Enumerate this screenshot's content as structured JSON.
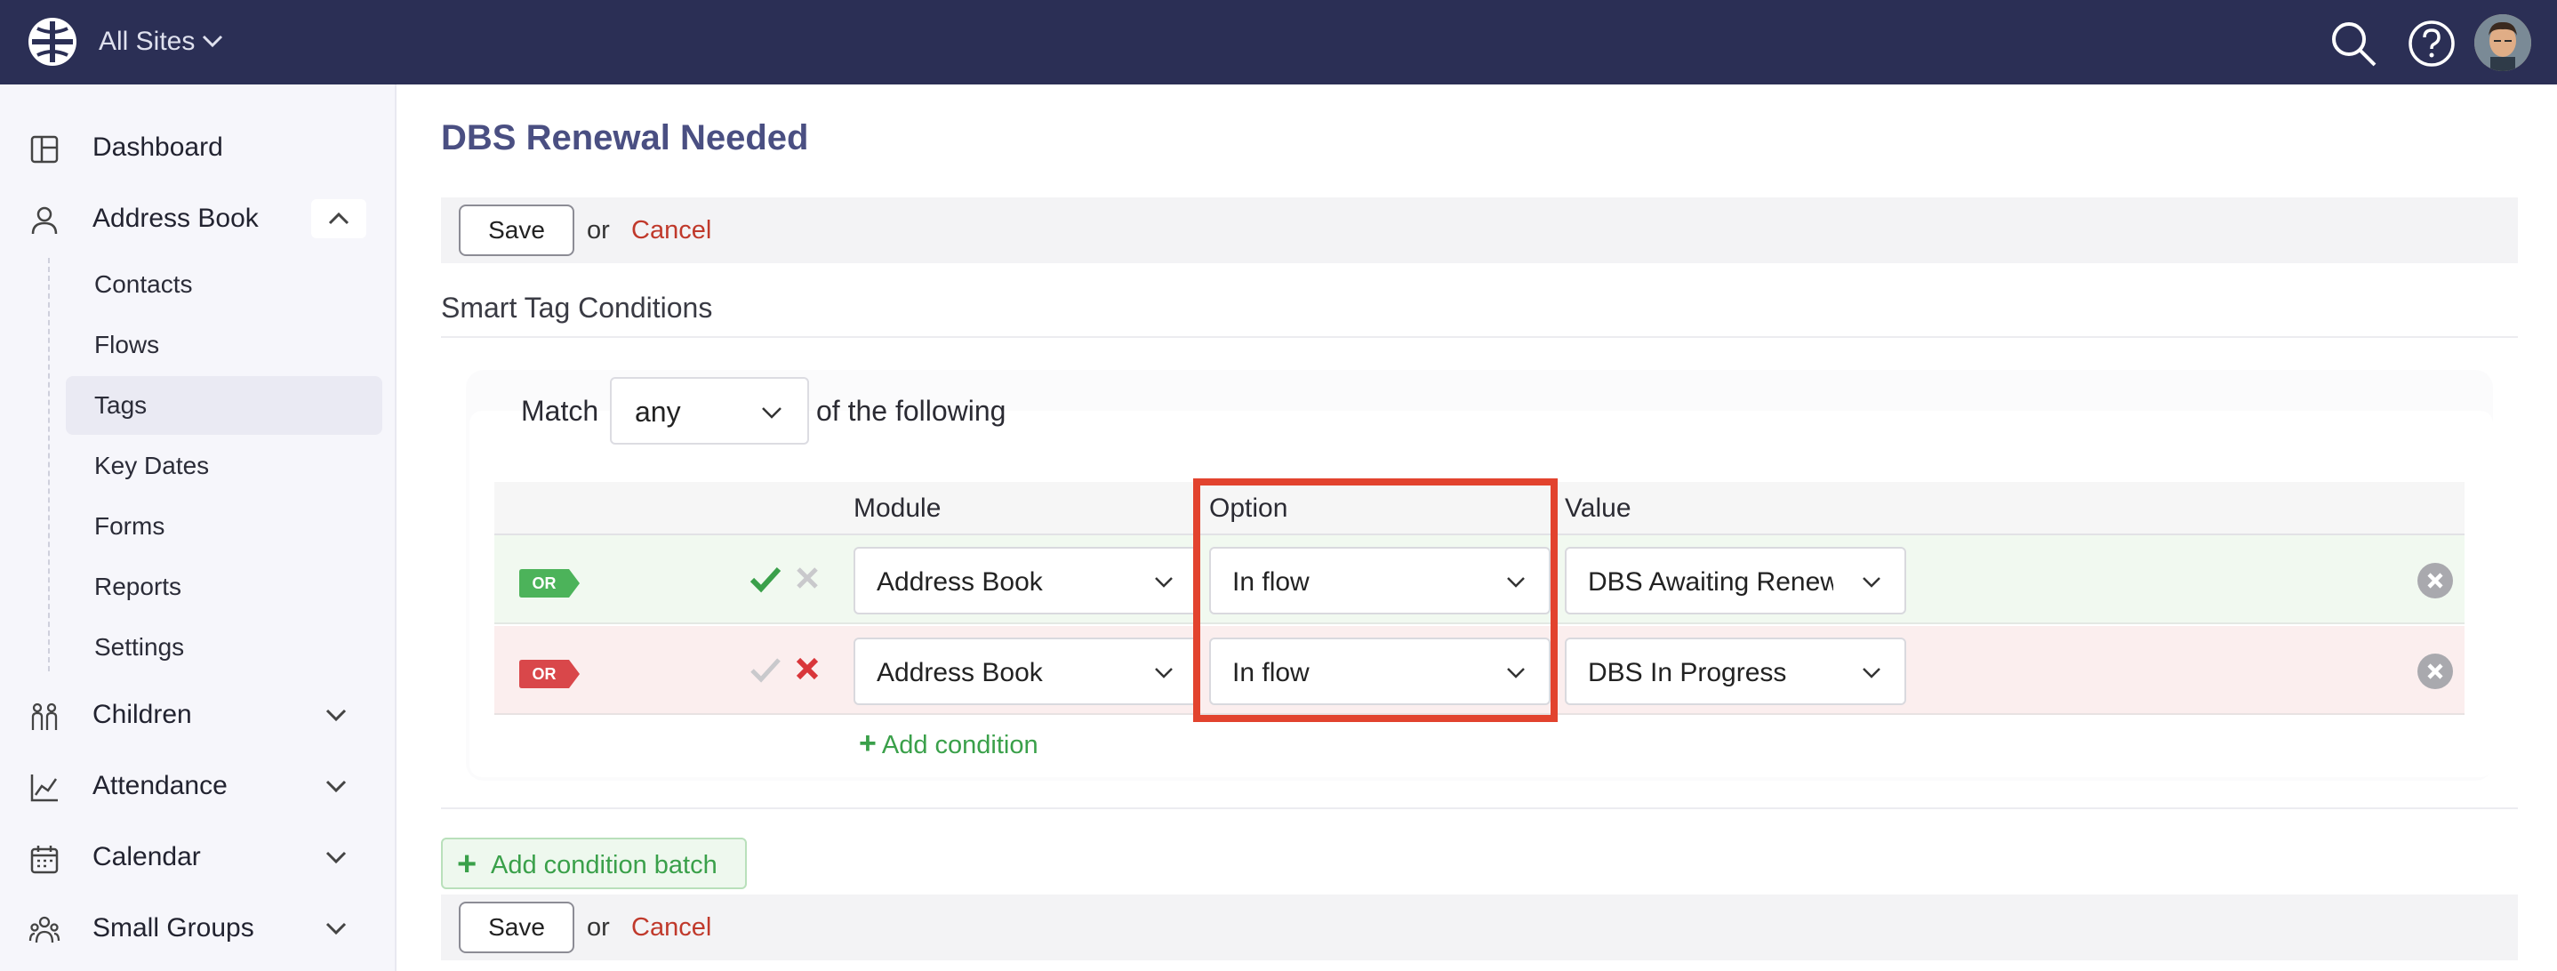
{
  "header": {
    "site_selector": "All Sites"
  },
  "sidebar": {
    "items": [
      {
        "label": "Dashboard",
        "icon": "dashboard-icon"
      },
      {
        "label": "Address Book",
        "icon": "person-icon",
        "expanded": true
      },
      {
        "label": "Children",
        "icon": "children-icon"
      },
      {
        "label": "Attendance",
        "icon": "chart-icon"
      },
      {
        "label": "Calendar",
        "icon": "calendar-icon"
      },
      {
        "label": "Small Groups",
        "icon": "group-icon"
      }
    ],
    "address_book_sub": [
      {
        "label": "Contacts"
      },
      {
        "label": "Flows"
      },
      {
        "label": "Tags",
        "active": true
      },
      {
        "label": "Key Dates"
      },
      {
        "label": "Forms"
      },
      {
        "label": "Reports"
      },
      {
        "label": "Settings"
      }
    ]
  },
  "main": {
    "title": "DBS Renewal Needed",
    "save_label": "Save",
    "or_label": "or",
    "cancel_label": "Cancel",
    "section_title": "Smart Tag Conditions",
    "match_label": "Match",
    "match_value": "any",
    "following_label": "of the following",
    "columns": {
      "module": "Module",
      "option": "Option",
      "value": "Value"
    },
    "rows": [
      {
        "badge": "OR",
        "state": "positive",
        "module": "Address Book",
        "option": "In flow",
        "value": "DBS Awaiting Renewal"
      },
      {
        "badge": "OR",
        "state": "negative",
        "module": "Address Book",
        "option": "In flow",
        "value": "DBS In Progress"
      }
    ],
    "add_condition": "Add condition",
    "add_condition_batch": "Add condition batch"
  },
  "colors": {
    "topbar": "#2b2f55",
    "accent_green": "#3aa04a",
    "accent_red": "#c0392b",
    "highlight": "#e2432e"
  }
}
